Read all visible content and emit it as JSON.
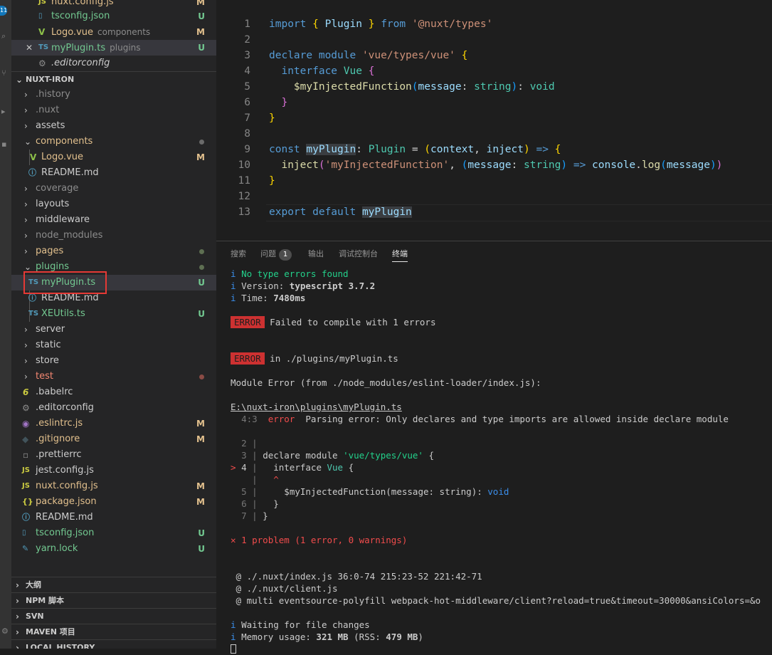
{
  "activity": {
    "badge": "11"
  },
  "explorer": {
    "open_editors": [
      {
        "name": "nuxt.config.js",
        "icon": "JS",
        "status": "M"
      },
      {
        "name": "tsconfig.json",
        "icon": "TS",
        "status": "U"
      },
      {
        "name": "Logo.vue",
        "desc": "components",
        "icon": "V",
        "status": "M"
      },
      {
        "name": "myPlugin.ts",
        "desc": "plugins",
        "icon": "TS",
        "status": "U"
      },
      {
        "name": ".editorconfig",
        "icon": "gear"
      }
    ],
    "project_title": "NUXT-IRON",
    "tree": [
      {
        "name": ".history",
        "status": ""
      },
      {
        "name": ".nuxt",
        "status": ""
      },
      {
        "name": "assets",
        "status": ""
      },
      {
        "name": "components",
        "status": "dot"
      },
      {
        "name": "Logo.vue",
        "status": "M"
      },
      {
        "name": "README.md",
        "status": ""
      },
      {
        "name": "coverage",
        "status": ""
      },
      {
        "name": "layouts",
        "status": ""
      },
      {
        "name": "middleware",
        "status": ""
      },
      {
        "name": "node_modules",
        "status": ""
      },
      {
        "name": "pages",
        "status": "dot"
      },
      {
        "name": "plugins",
        "status": "dot"
      },
      {
        "name": "myPlugin.ts",
        "status": "U"
      },
      {
        "name": "README.md",
        "status": ""
      },
      {
        "name": "XEUtils.ts",
        "status": "U"
      },
      {
        "name": "server",
        "status": ""
      },
      {
        "name": "static",
        "status": ""
      },
      {
        "name": "store",
        "status": ""
      },
      {
        "name": "test",
        "status": "dot"
      },
      {
        "name": ".babelrc",
        "status": ""
      },
      {
        "name": ".editorconfig",
        "status": ""
      },
      {
        "name": ".eslintrc.js",
        "status": "M"
      },
      {
        "name": ".gitignore",
        "status": "M"
      },
      {
        "name": ".prettierrc",
        "status": ""
      },
      {
        "name": "jest.config.js",
        "status": ""
      },
      {
        "name": "nuxt.config.js",
        "status": "M"
      },
      {
        "name": "package.json",
        "status": "M"
      },
      {
        "name": "README.md",
        "status": ""
      },
      {
        "name": "tsconfig.json",
        "status": "U"
      },
      {
        "name": "yarn.lock",
        "status": "U"
      }
    ],
    "sections": [
      "大纲",
      "NPM 脚本",
      "SVN",
      "MAVEN 项目",
      "LOCAL HISTORY"
    ]
  },
  "editor": {
    "line_numbers": [
      "1",
      "2",
      "3",
      "4",
      "5",
      "6",
      "7",
      "8",
      "9",
      "10",
      "11",
      "12",
      "13"
    ],
    "code": {
      "l1_kw": "import",
      "l1_name": "Plugin",
      "l1_from": "from",
      "l1_str": "'@nuxt/types'",
      "l3_kw": "declare module",
      "l3_str": "'vue/types/vue'",
      "l4_kw": "interface",
      "l4_ty": "Vue",
      "l5_fn": "$myInjectedFunction",
      "l5_param": "message",
      "l5_type": "string",
      "l5_ret": "void",
      "l9_kw": "const",
      "l9_name": "myPlugin",
      "l9_ty": "Plugin",
      "l9_p1": "context",
      "l9_p2": "inject",
      "l10_fn": "inject",
      "l10_str": "'myInjectedFunction'",
      "l10_p": "message",
      "l10_ty": "string",
      "l10_obj": "console",
      "l10_m": "log",
      "l10_arg": "message",
      "l13_kw": "export default",
      "l13_name": "myPlugin"
    }
  },
  "panel": {
    "tabs": [
      "搜索",
      "问题",
      "输出",
      "调试控制台",
      "终端"
    ],
    "problem_count": "1",
    "terminal": {
      "l1": "No type errors found",
      "l2a": "Version: ",
      "l2b": "typescript 3.7.2",
      "l3a": "Time: ",
      "l3b": "7480ms",
      "error_tag": "ERROR",
      "l4": "Failed to compile with 1 errors",
      "l5": "in ./plugins/myPlugin.ts",
      "l6": "Module Error (from ./node_modules/eslint-loader/index.js):",
      "l7": "E:\\nuxt-iron\\plugins\\myPlugin.ts",
      "l8_pos": "4:3",
      "l8_sev": "error",
      "l8_msg": "Parsing error: Only declares and type imports are allowed inside declare module",
      "f2": "2",
      "f3": "3",
      "f3_code": "declare module",
      "f3_str": "'vue/types/vue'",
      "f4": "4",
      "f4_code": "interface",
      "f4_ty": "Vue",
      "f5": "5",
      "f5_code": "$myInjectedFunction(message: string): ",
      "f5_kw": "void",
      "f6": "6",
      "f7": "7",
      "problem": "1 problem (1 error, 0 warnings)",
      "s1": "@ ./.nuxt/index.js 36:0-74 215:23-52 221:42-71",
      "s2": "@ ./.nuxt/client.js",
      "s3": "@ multi eventsource-polyfill webpack-hot-middleware/client?reload=true&timeout=30000&ansiColors=&o",
      "w1": "Waiting for file changes",
      "w2a": "Memory usage: ",
      "w2b": "321 MB",
      "w2c": " (RSS: ",
      "w2d": "479 MB",
      "w2e": ")"
    }
  },
  "colors": {
    "modified": "#e2c08d",
    "untracked": "#73c991",
    "error": "#f48771",
    "highlight_box": "#e53935"
  }
}
